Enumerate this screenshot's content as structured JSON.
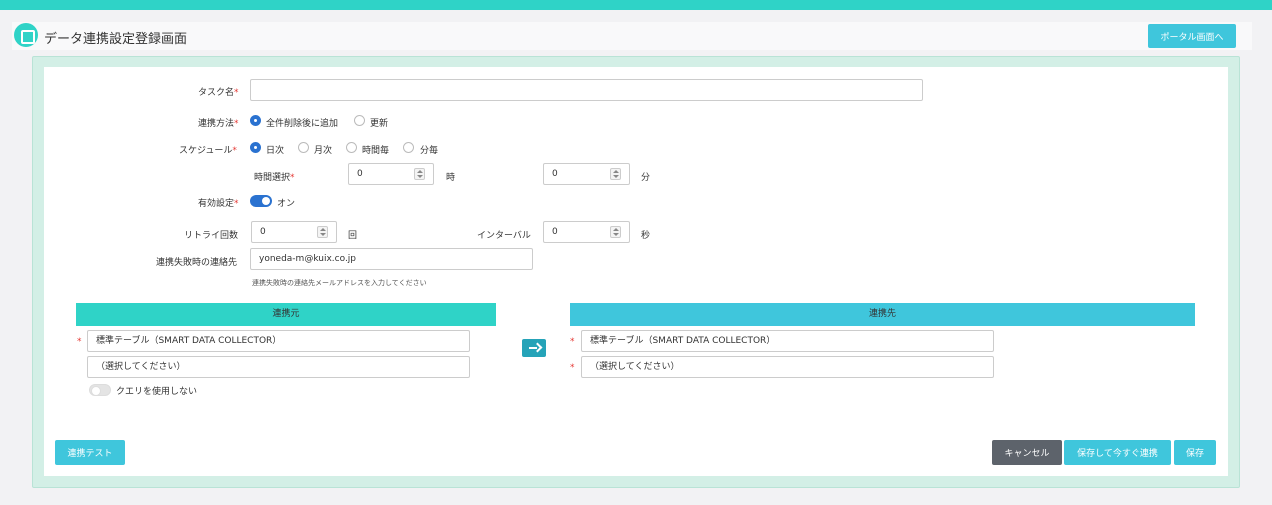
{
  "header": {
    "title": "データ連携設定登録画面",
    "portal_button": "ポータル画面へ"
  },
  "form": {
    "task_name": {
      "label": "タスク名",
      "required": "*",
      "value": ""
    },
    "sync_method": {
      "label": "連携方法",
      "required": "*",
      "options": [
        "全件削除後に追加",
        "更新"
      ],
      "selected": "全件削除後に追加"
    },
    "schedule": {
      "label": "スケジュール",
      "required": "*",
      "options": [
        "日次",
        "月次",
        "時間毎",
        "分毎"
      ],
      "selected": "日次"
    },
    "time_select": {
      "label": "時間選択",
      "required": "*",
      "hour_value": "0",
      "hour_unit": "時",
      "minute_value": "0",
      "minute_unit": "分"
    },
    "enabled": {
      "label": "有効設定",
      "required": "*",
      "state_label": "オン",
      "on": true
    },
    "retry": {
      "label": "リトライ回数",
      "value": "0",
      "unit": "回"
    },
    "interval": {
      "label": "インターバル",
      "value": "0",
      "unit": "秒"
    },
    "failure_contact": {
      "label": "連携失敗時の連絡先",
      "value": "yoneda-m@kuix.co.jp",
      "hint": "連携失敗時の連絡先メールアドレスを入力してください"
    }
  },
  "source": {
    "header": "連携元",
    "required": "*",
    "table_value": "標準テーブル（SMART DATA COLLECTOR）",
    "select_value": "（選択してください）",
    "query_toggle_label": "クエリを使用しない"
  },
  "destination": {
    "header": "連携先",
    "required": "*",
    "table_value": "標準テーブル（SMART DATA COLLECTOR）",
    "select_value": "（選択してください）"
  },
  "buttons": {
    "test": "連携テスト",
    "cancel": "キャンセル",
    "save_and_sync": "保存して今すぐ連携",
    "save": "保存"
  },
  "colors": {
    "accent": "#2fd3c7",
    "source_header": "#2fd3c7",
    "destination_header": "#3fc6dc",
    "button": "#3fc6dc",
    "cancel_button": "#5d636b",
    "radio_selected": "#2a72d0"
  },
  "icons": {
    "logo": "app-logo-icon",
    "transfer": "arrow-right-icon"
  }
}
